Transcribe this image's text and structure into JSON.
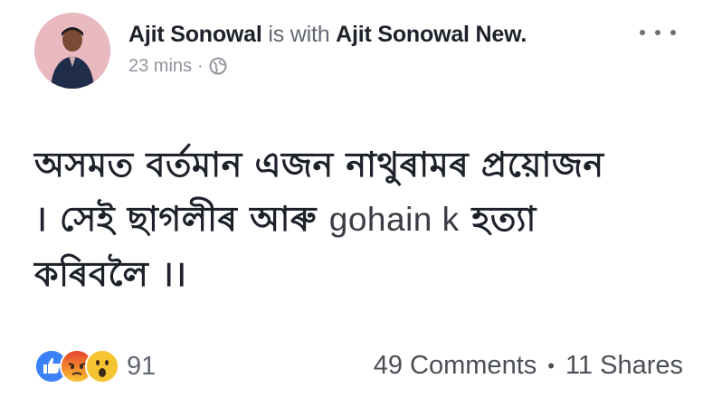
{
  "post": {
    "author": "Ajit Sonowal",
    "with_text": "is with",
    "tagged": "Ajit Sonowal New.",
    "time": "23 mins",
    "dot_sep": "·",
    "privacy_icon": "globe-icon",
    "more_icon": "more-dots-icon",
    "body_lines": [
      {
        "parts": [
          {
            "text": "অসমত বৰ্তমান এজন নাথুৰামৰ প্ৰয়োজন",
            "latin": false
          }
        ]
      },
      {
        "parts": [
          {
            "text": "। সেই ছাগলীৰ আৰু ",
            "latin": false
          },
          {
            "text": "gohain k",
            "latin": true
          },
          {
            "text": " হত্যা",
            "latin": false
          }
        ]
      },
      {
        "parts": [
          {
            "text": "কৰিবলৈ ।।",
            "latin": false
          }
        ]
      }
    ]
  },
  "reactions": {
    "icons": [
      "like-icon",
      "angry-icon",
      "wow-icon"
    ],
    "count": "91"
  },
  "stats": {
    "comments": "49 Comments",
    "separator": "•",
    "shares": "11 Shares"
  },
  "colors": {
    "like": "#3b82f6",
    "angry": "#f0613b",
    "wow": "#f7c431",
    "meta": "#90949c"
  }
}
